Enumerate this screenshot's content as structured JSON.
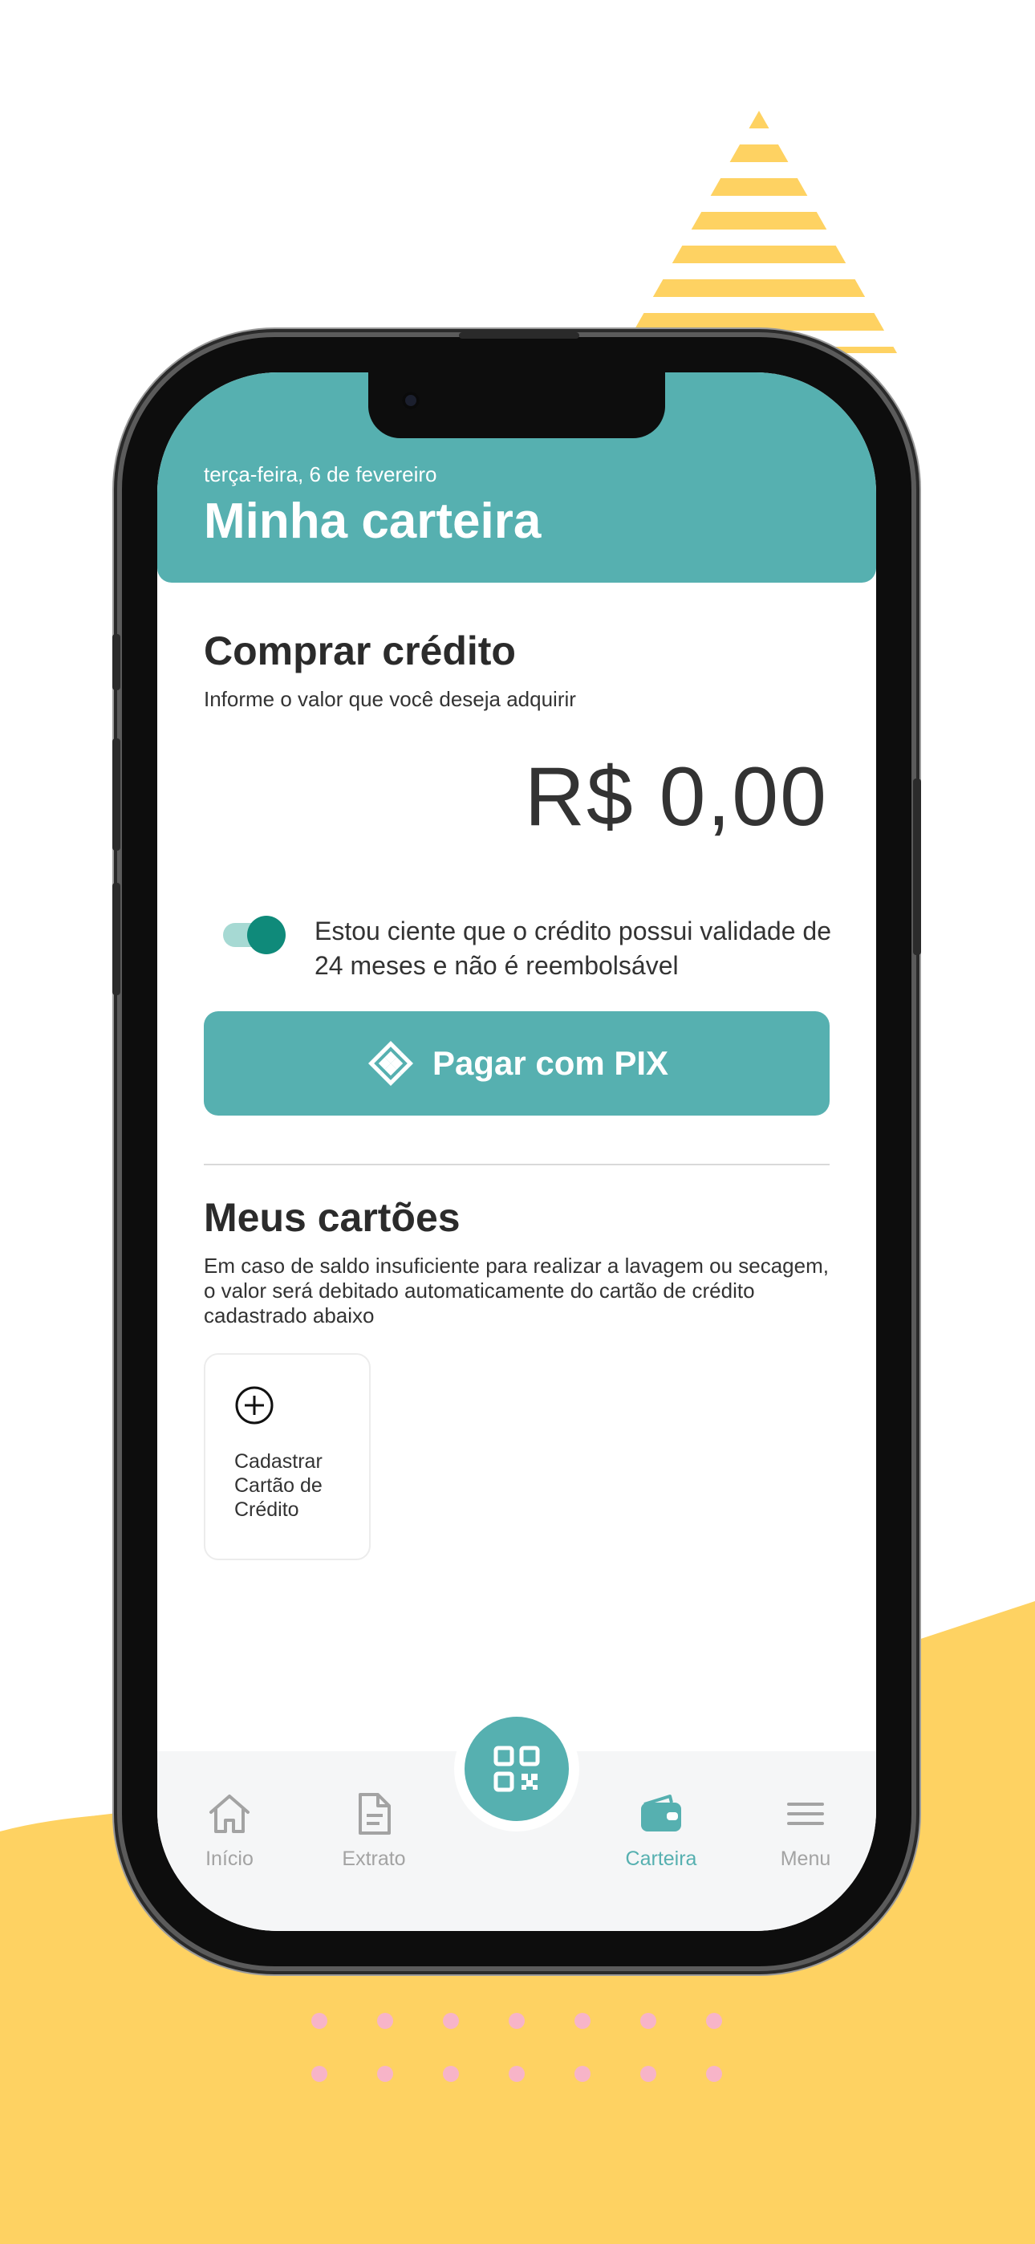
{
  "colors": {
    "brand": "#56b0b0",
    "yellow": "#fed262",
    "dots": "#f7b4c8",
    "toggle_on": "#0f8a7a"
  },
  "header": {
    "date": "terça-feira, 6 de fevereiro",
    "title": "Minha carteira"
  },
  "buy_credit": {
    "title": "Comprar crédito",
    "subtitle": "Informe o valor que você deseja adquirir",
    "amount": "R$ 0,00",
    "consent_checked": true,
    "consent_text": "Estou ciente que o crédito possui validade de 24 meses e não é reembolsável",
    "pay_button": "Pagar com PIX",
    "pay_icon": "pix-icon"
  },
  "cards": {
    "title": "Meus cartões",
    "subtitle": "Em caso de saldo insuficiente para realizar a lavagem ou secagem, o valor será debitado automaticamente do cartão de crédito cadastrado abaixo",
    "add_card_label": "Cadastrar Cartão de Crédito",
    "add_icon": "plus-circle-icon"
  },
  "tabbar": {
    "items": [
      {
        "label": "Início",
        "icon": "home-icon",
        "active": false
      },
      {
        "label": "Extrato",
        "icon": "document-icon",
        "active": false
      },
      {
        "label": "Carteira",
        "icon": "wallet-icon",
        "active": true
      },
      {
        "label": "Menu",
        "icon": "menu-icon",
        "active": false
      }
    ],
    "center_icon": "qr-code-icon"
  }
}
